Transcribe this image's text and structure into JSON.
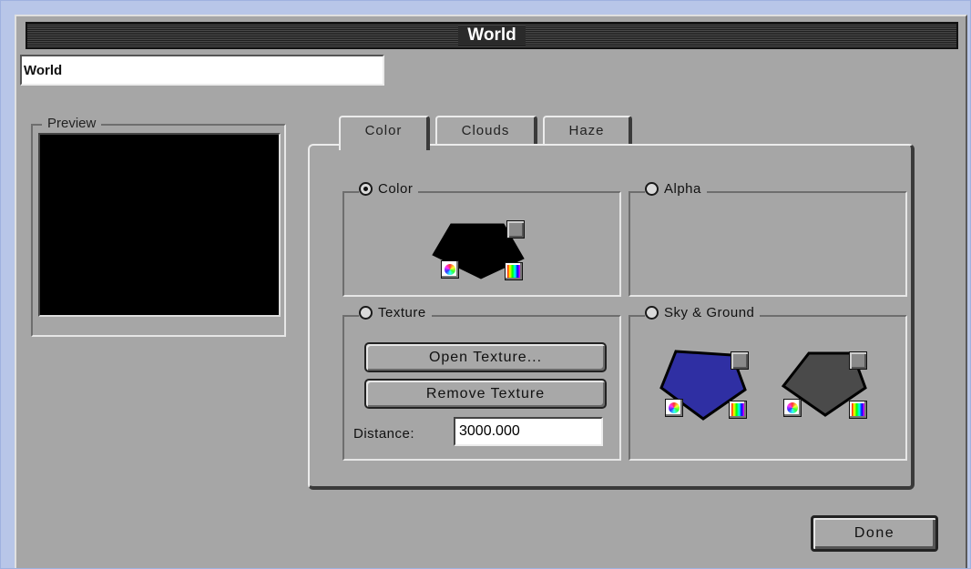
{
  "window": {
    "title": "World"
  },
  "name_field": {
    "value": "World"
  },
  "preview": {
    "label": "Preview"
  },
  "tabs": [
    {
      "label": "Color",
      "active": true
    },
    {
      "label": "Clouds",
      "active": false
    },
    {
      "label": "Haze",
      "active": false
    }
  ],
  "color_group": {
    "label": "Color",
    "selected": true
  },
  "alpha_group": {
    "label": "Alpha",
    "selected": false
  },
  "texture_group": {
    "label": "Texture",
    "selected": false,
    "open_button": "Open Texture...",
    "remove_button": "Remove Texture",
    "distance_label": "Distance:",
    "distance_value": "3000.000"
  },
  "sky_ground_group": {
    "label": "Sky & Ground",
    "selected": false
  },
  "swatch_colors": {
    "color": "#000000",
    "sky": "#2f2fa3",
    "ground": "#4a4a4a"
  },
  "done_button": "Done",
  "icons": [
    "color-wheel-icon",
    "color-gradient-icon",
    "color-swatch-icon"
  ]
}
